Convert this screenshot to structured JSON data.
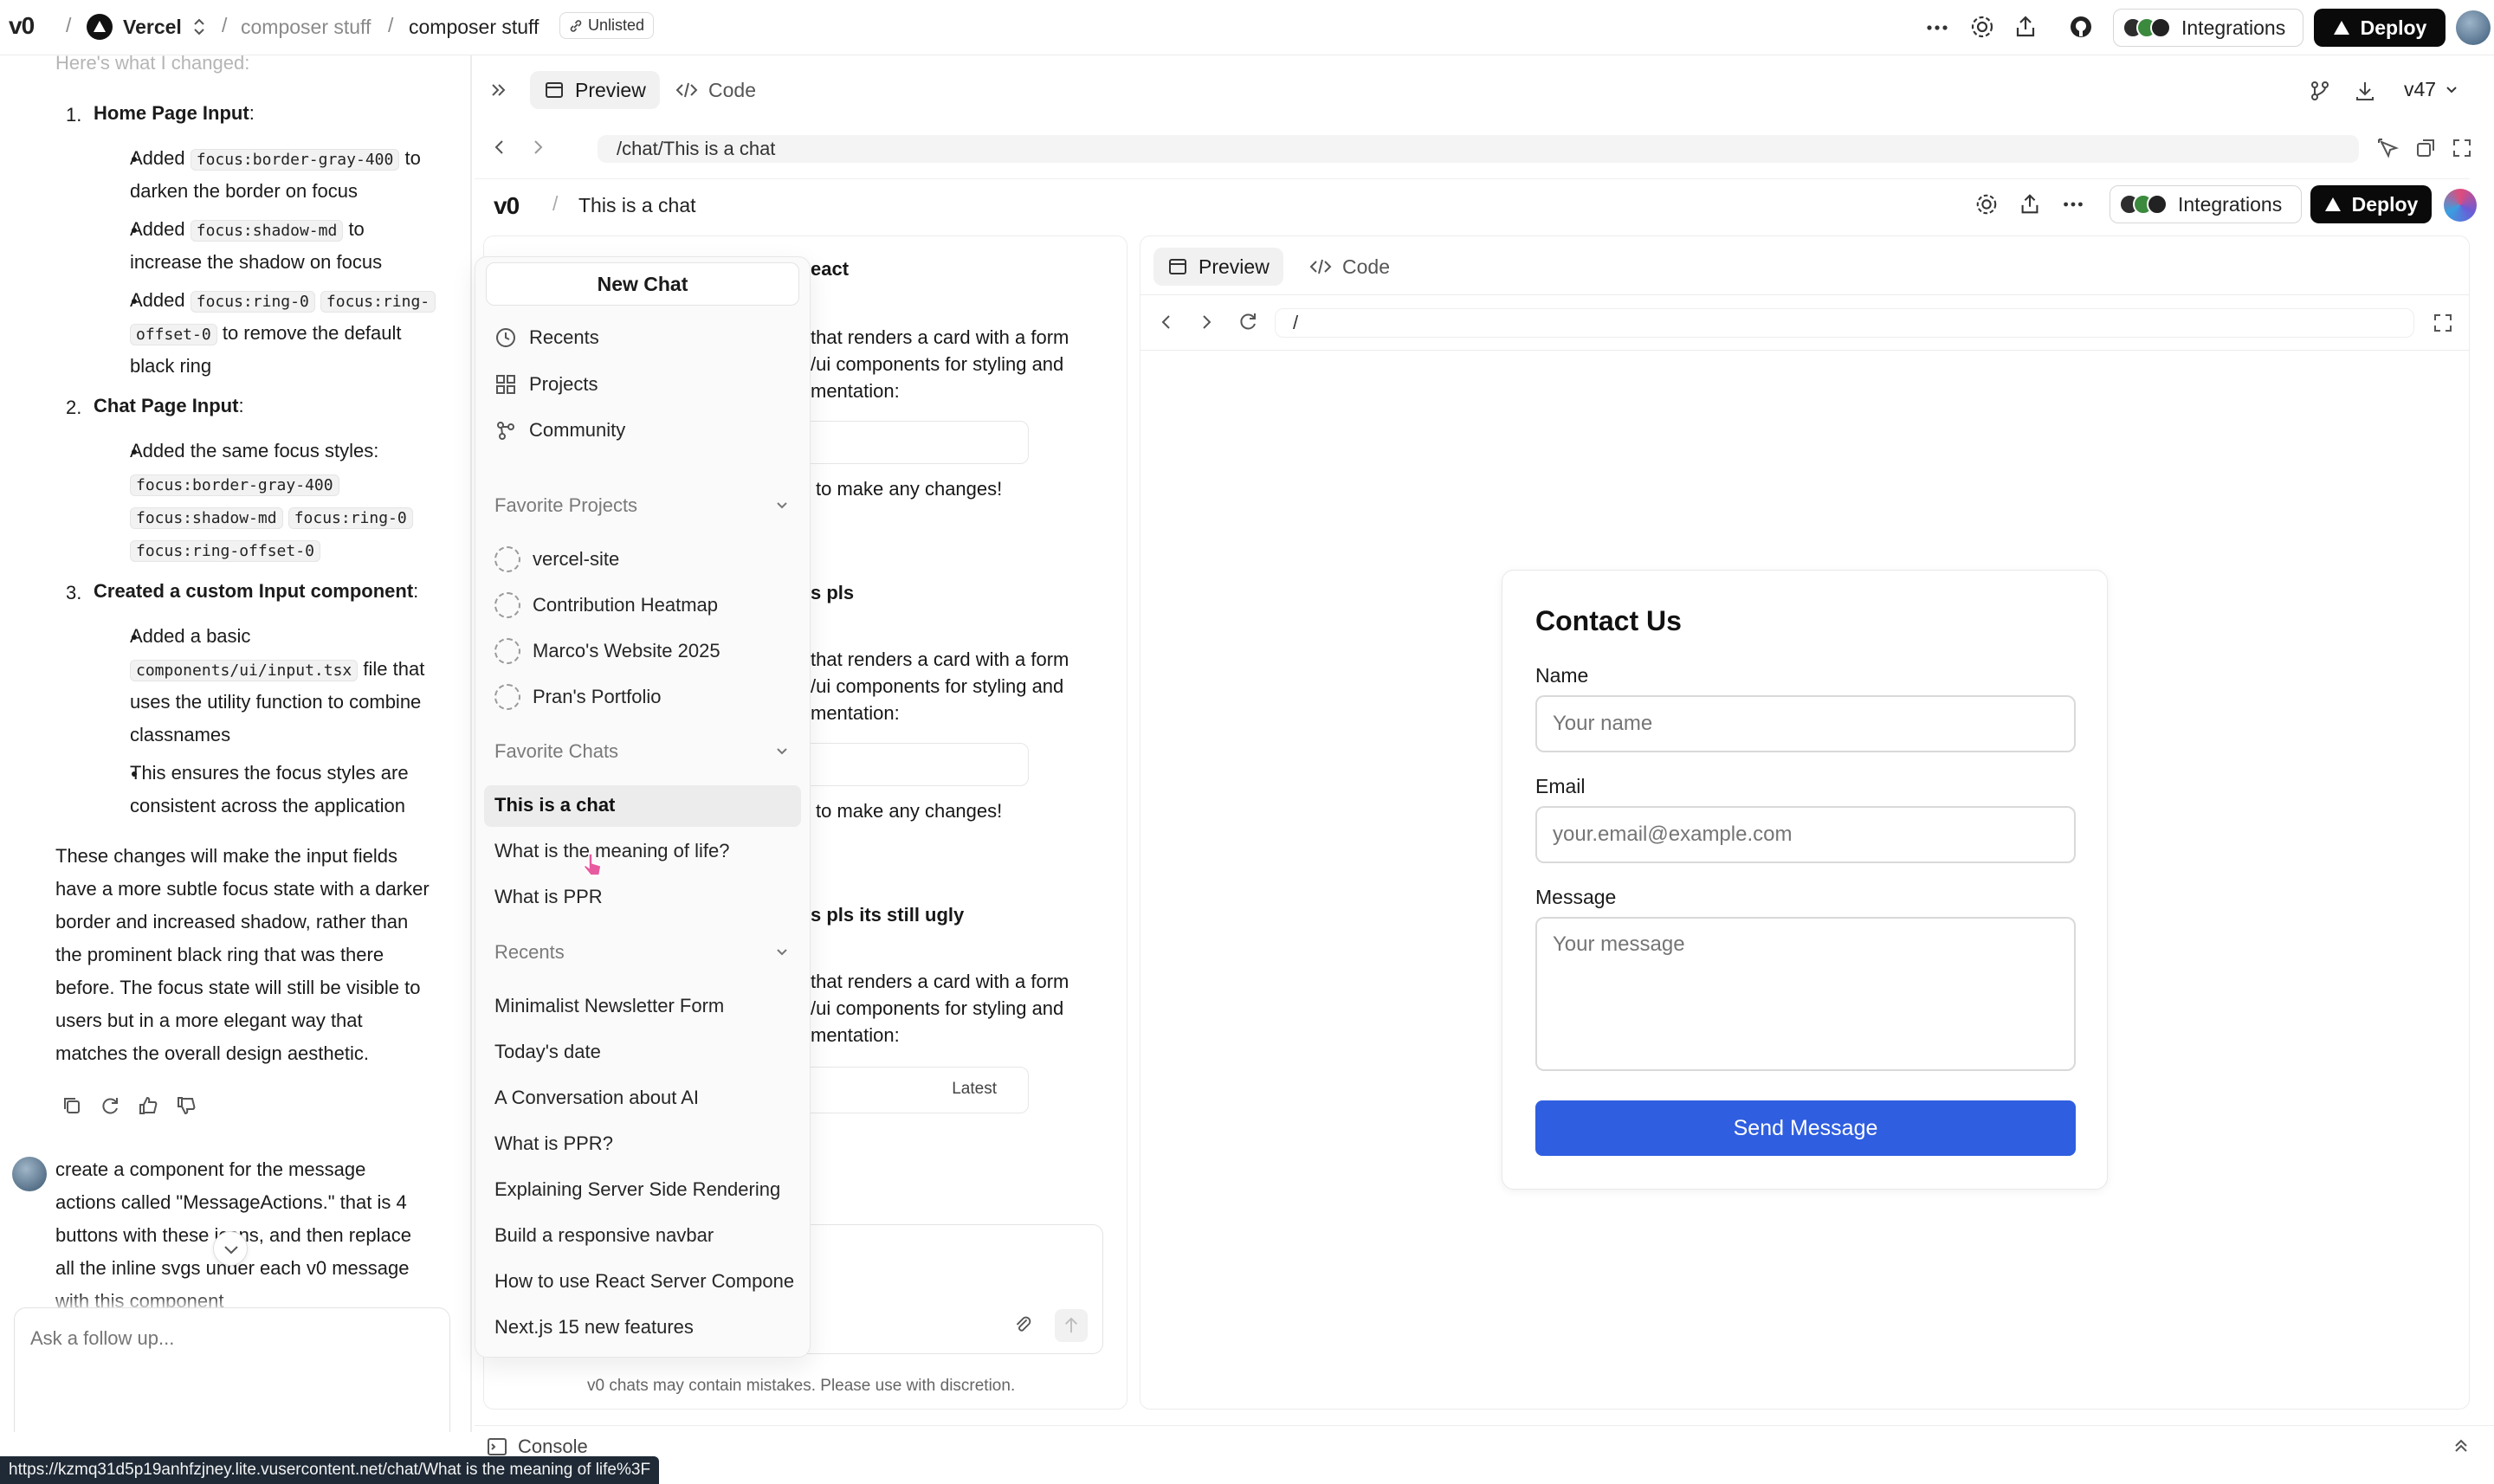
{
  "topbar": {
    "logo": "v0",
    "team": "Vercel",
    "crumb1": "composer stuff",
    "crumb2": "composer stuff",
    "visibility": "Unlisted",
    "integrations": "Integrations",
    "deploy": "Deploy"
  },
  "left": {
    "cut_top": "Here's what I changed:",
    "items": [
      {
        "num": "1.",
        "title": "Home Page Input",
        "suffix": ":"
      },
      {
        "num": "2.",
        "title": "Chat Page Input",
        "suffix": ":"
      },
      {
        "num": "3.",
        "title": "Created a custom Input component",
        "suffix": ":"
      }
    ],
    "b1": {
      "pre": "Added",
      "code": "focus:border-gray-400",
      "post": "to",
      "l2": "darken the border on focus"
    },
    "b2": {
      "pre": "Added",
      "code": "focus:shadow-md",
      "post": "to",
      "l2": "increase the shadow on focus"
    },
    "b3": {
      "pre": "Added",
      "code1": "focus:ring-0",
      "code2": "focus:ring-",
      "code3": "offset-0",
      "post": "to remove the default",
      "l3": "black ring"
    },
    "b4": {
      "l1": "Added the same focus styles:",
      "code1": "focus:border-gray-400",
      "code2": "focus:shadow-md",
      "code3": "focus:ring-0",
      "code4": "focus:ring-offset-0"
    },
    "b5": {
      "l1": "Added a basic",
      "code": "components/ui/input.tsx",
      "post": "file that",
      "l3": "uses the utility function to combine",
      "l4": "classnames"
    },
    "b6": {
      "l1": "This ensures the focus styles are",
      "l2": "consistent across the application"
    },
    "summary": [
      "These changes will make the input fields",
      "have a more subtle focus state with a darker",
      "border and increased shadow, rather than",
      "the prominent black ring that was there",
      "before. The focus state will still be visible to",
      "users but in a more elegant way that",
      "matches the overall design aesthetic."
    ],
    "user_msg": [
      "create a component for the message",
      "actions called \"MessageActions.\" that is 4",
      "buttons with these icons, and then replace",
      "all the inline svgs under each v0 message",
      "with this component"
    ],
    "input_placeholder": "Ask a follow up..."
  },
  "preview": {
    "tab_preview": "Preview",
    "tab_code": "Code",
    "version": "v47",
    "url": "/chat/This is a chat"
  },
  "inner": {
    "logo": "v0",
    "title": "This is a chat",
    "integrations": "Integrations",
    "deploy": "Deploy",
    "tab_preview": "Preview",
    "tab_code": "Code",
    "url": "/",
    "disclaimer": "v0 chats may contain mistakes. Please use with discretion.",
    "bg": {
      "h1": "eact",
      "a1": "that renders a card with a form",
      "a2": "/ui components for styling and",
      "a3": "mentation:",
      "c1": "to make any changes!",
      "h2": "s pls",
      "d1": "that renders a card with a form",
      "d2": "/ui components for styling and",
      "d3": "mentation:",
      "c2": "to make any changes!",
      "h3": "s pls its still ugly",
      "e1": "that renders a card with a form",
      "e2": "/ui components for styling and",
      "e3": "mentation:",
      "latest": "Latest"
    }
  },
  "sidebar": {
    "new_chat": "New Chat",
    "nav": [
      "Recents",
      "Projects",
      "Community"
    ],
    "favorite_projects_label": "Favorite Projects",
    "projects": [
      "vercel-site",
      "Contribution Heatmap",
      "Marco's Website 2025",
      "Pran's Portfolio"
    ],
    "favorite_chats_label": "Favorite Chats",
    "fav_chats": [
      "This is a chat",
      "What is the meaning of life?",
      "What is PPR"
    ],
    "recents_label": "Recents",
    "recents": [
      "Minimalist Newsletter Form",
      "Today's date",
      "A Conversation about AI",
      "What is PPR?",
      "Explaining Server Side Rendering",
      "Build a responsive navbar",
      "How to use React Server Compone",
      "Next.js 15 new features"
    ]
  },
  "contact": {
    "title": "Contact Us",
    "name_label": "Name",
    "name_placeholder": "Your name",
    "email_label": "Email",
    "email_placeholder": "your.email@example.com",
    "message_label": "Message",
    "message_placeholder": "Your message",
    "submit": "Send Message"
  },
  "console": "Console",
  "status_url": "https://kzmq31d5p19anhfzjney.lite.vusercontent.net/chat/What is the meaning of life%3F",
  "colors": {
    "accent": "#2f5ee0",
    "dark": "#0a0a0a"
  }
}
